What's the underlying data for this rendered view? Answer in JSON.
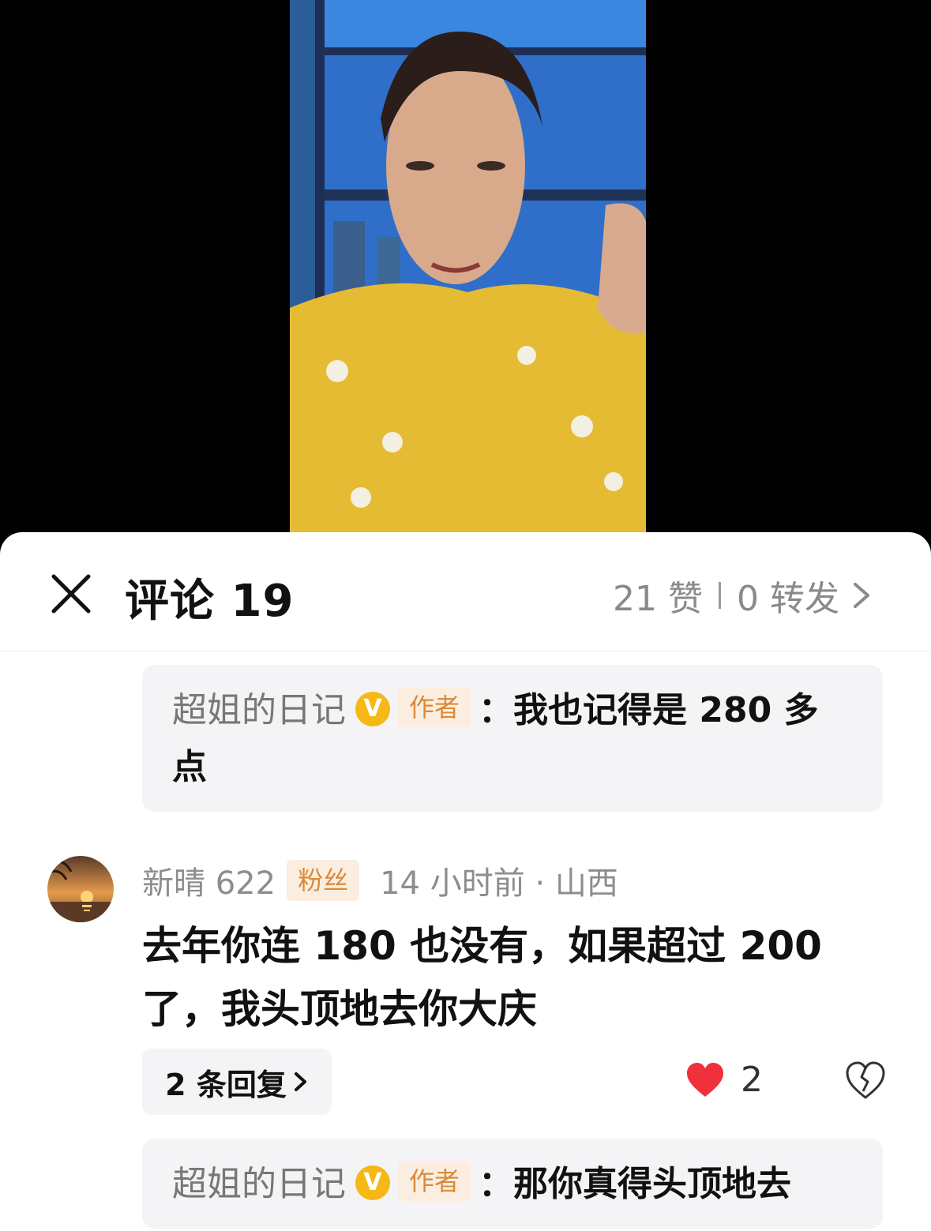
{
  "header": {
    "title": "评论 19",
    "likes_text": "21 赞",
    "shares_text": "0 转发"
  },
  "replies": [
    {
      "author": "超姐的日记",
      "verified_badge": "V",
      "tag": "作者",
      "text": "：我也记得是 280 多点"
    },
    {
      "author": "超姐的日记",
      "verified_badge": "V",
      "tag": "作者",
      "text": "：那你真得头顶地去"
    }
  ],
  "comment": {
    "author": "新晴 622",
    "tag": "粉丝",
    "time_location": "14 小时前 · 山西",
    "text": "去年你连 180 也没有，如果超过 200 了，我头顶地去你大庆",
    "replies_label": "2 条回复",
    "like_count": "2"
  },
  "colors": {
    "like_red": "#f0303a",
    "tag_bg": "#fbeee0",
    "tag_text": "#d98a3a",
    "verified": "#f6b816"
  }
}
